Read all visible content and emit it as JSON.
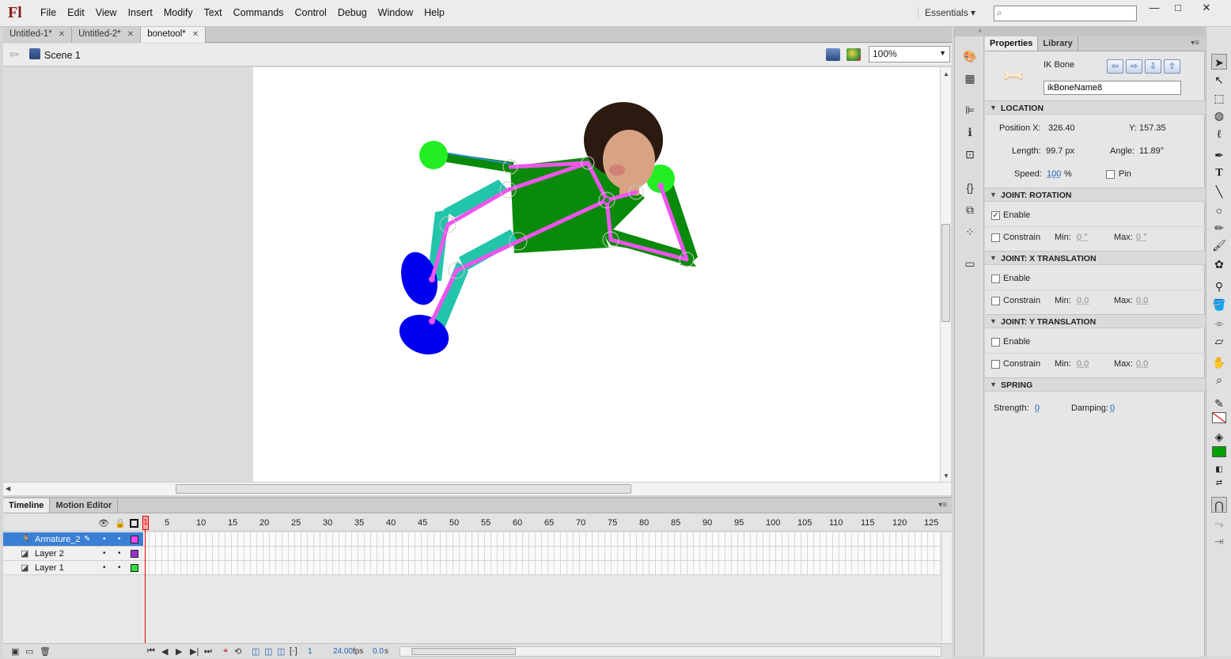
{
  "app": {
    "logo": "Fl",
    "workspace": "Essentials ▾",
    "search_placeholder": ""
  },
  "menu": [
    "File",
    "Edit",
    "View",
    "Insert",
    "Modify",
    "Text",
    "Commands",
    "Control",
    "Debug",
    "Window",
    "Help"
  ],
  "window_controls": {
    "minimize": "—",
    "maximize": "□",
    "close": "✕"
  },
  "doc_tabs": [
    {
      "label": "Untitled-1*",
      "close": "✕"
    },
    {
      "label": "Untitled-2*",
      "close": "✕"
    },
    {
      "label": "bonetool*",
      "close": "✕"
    }
  ],
  "editbar": {
    "scene": "Scene 1",
    "zoom": "100%"
  },
  "timeline": {
    "tabs": [
      "Timeline",
      "Motion Editor"
    ],
    "frame_numbers": [
      "1",
      "5",
      "10",
      "15",
      "20",
      "25",
      "30",
      "35",
      "40",
      "45",
      "50",
      "55",
      "60",
      "65",
      "70",
      "75",
      "80",
      "85",
      "90",
      "95",
      "100",
      "105",
      "110",
      "115",
      "120",
      "125"
    ],
    "layers": [
      {
        "name": "Armature_2",
        "color": "#ff44ff",
        "selected": true
      },
      {
        "name": "Layer 2",
        "color": "#9933cc",
        "selected": false
      },
      {
        "name": "Layer 1",
        "color": "#33dd33",
        "selected": false
      }
    ],
    "footer": {
      "current_frame": "1",
      "fps_value": "24.00",
      "fps_label": "fps",
      "time_value": "0.0",
      "time_label": "s"
    }
  },
  "properties": {
    "tabs": [
      "Properties",
      "Library"
    ],
    "object_type": "IK Bone",
    "bone_name": "ikBoneName8",
    "location": {
      "title": "LOCATION",
      "position_x_label": "Position X:",
      "position_x": "326.40",
      "y_label": "Y:",
      "y": "157.35",
      "length_label": "Length:",
      "length": "99.7 px",
      "angle_label": "Angle:",
      "angle": "11.89°",
      "speed_label": "Speed:",
      "speed": "100",
      "speed_unit": "%",
      "pin_label": "Pin"
    },
    "joint_rotation": {
      "title": "JOINT: ROTATION",
      "enable_label": "Enable",
      "constrain_label": "Constrain",
      "min_label": "Min:",
      "min": "0 °",
      "max_label": "Max:",
      "max": "0 °"
    },
    "joint_x": {
      "title": "JOINT: X TRANSLATION",
      "enable_label": "Enable",
      "constrain_label": "Constrain",
      "min_label": "Min:",
      "min": "0.0",
      "max_label": "Max:",
      "max": "0.0"
    },
    "joint_y": {
      "title": "JOINT: Y TRANSLATION",
      "enable_label": "Enable",
      "constrain_label": "Constrain",
      "min_label": "Min:",
      "min": "0.0",
      "max_label": "Max:",
      "max": "0.0"
    },
    "spring": {
      "title": "SPRING",
      "strength_label": "Strength:",
      "strength": "0",
      "damping_label": "Damping:",
      "damping": "0"
    }
  },
  "colors": {
    "stroke": "#ffffff",
    "fill": "#00a000",
    "bone": "#ee55ee",
    "torso": "#0a8a0a",
    "limb": "#22c4aa",
    "foot": "#0000ee"
  }
}
